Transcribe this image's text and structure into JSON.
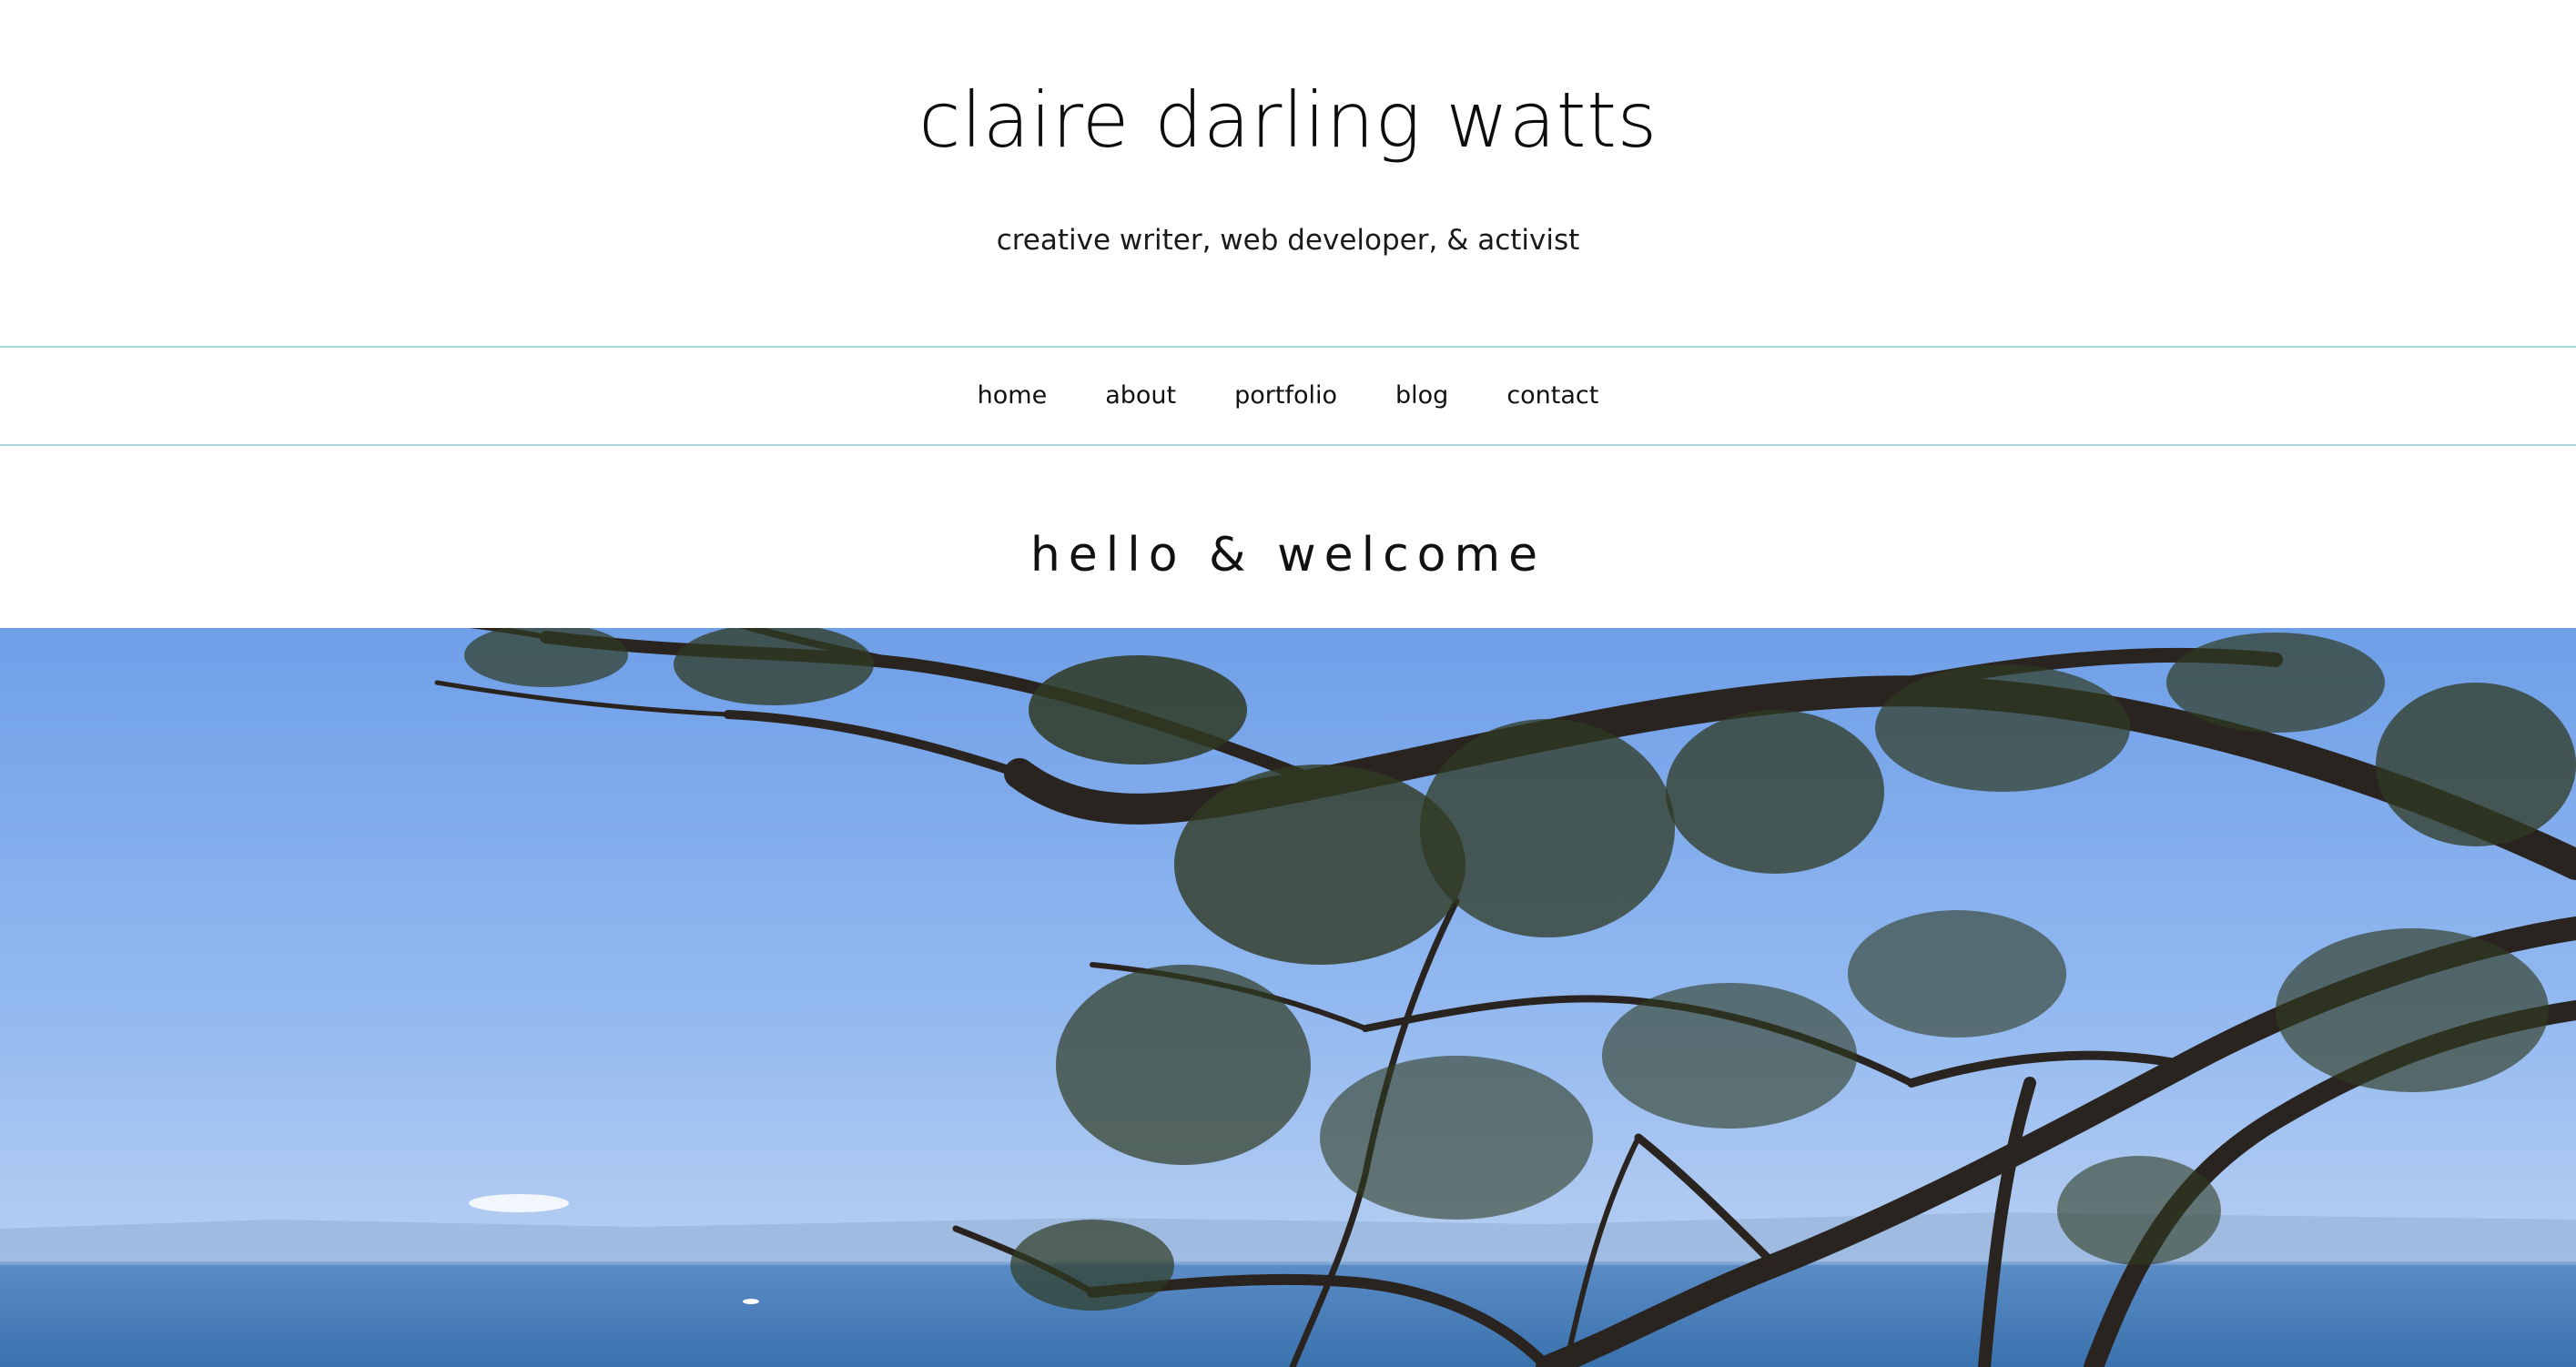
{
  "site": {
    "title": "claire darling watts",
    "tagline": "creative writer, web developer, & activist"
  },
  "nav": {
    "items": [
      {
        "label": "home"
      },
      {
        "label": "about"
      },
      {
        "label": "portfolio"
      },
      {
        "label": "blog"
      },
      {
        "label": "contact"
      }
    ]
  },
  "main": {
    "heading": "hello & welcome"
  },
  "colors": {
    "nav_border": "#a9d6df",
    "sky_top": "#6f9fe8",
    "sky_bottom": "#a9c8f4",
    "sea": "#3f78b4",
    "branch": "#2a2420",
    "foliage": "#2f3a22"
  },
  "hero": {
    "image_name": "coastal-tree-photo"
  }
}
